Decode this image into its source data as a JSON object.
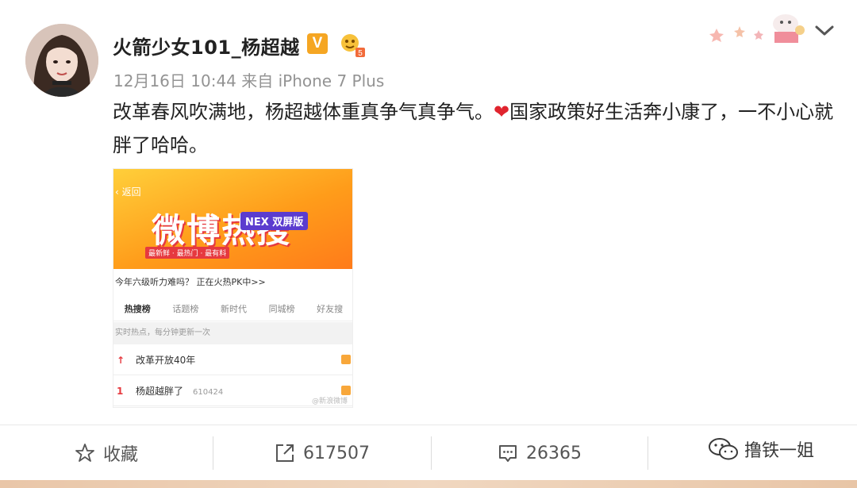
{
  "post": {
    "username": "火箭少女101_杨超越",
    "verified_badge": "V",
    "level_badge": "5",
    "meta": "12月16日 10:44 来自 iPhone 7 Plus",
    "content_before_emoji": "改革春风吹满地，杨超越体重真争气真争气。",
    "emoji": "❤",
    "content_after_emoji": "国家政策好生活奔小康了，一不小心就胖了哈哈。",
    "colors": {
      "accent": "#f5a623",
      "heart": "#e0242e"
    }
  },
  "image": {
    "back_label": "返回",
    "banner_title": "微博热搜",
    "nex_tag": "NEX 双屏版",
    "banner_sub": "最新鲜 · 最热门 · 最有料",
    "promo": "今年六级听力难吗？ 正在火热PK中>>",
    "tabs": [
      {
        "label": "热搜榜"
      },
      {
        "label": "话题榜"
      },
      {
        "label": "新时代"
      },
      {
        "label": "同城榜"
      },
      {
        "label": "好友搜"
      }
    ],
    "section_hint": "实时热点，每分钟更新一次",
    "rows": [
      {
        "rank": "↑",
        "text": "改革开放40年",
        "count": ""
      },
      {
        "rank": "1",
        "text": "杨超越胖了",
        "count": "610424"
      }
    ],
    "watermark": "@新浪微博"
  },
  "actions": {
    "favorite": "收藏",
    "repost": "617507",
    "comment": "26365"
  },
  "watermark": {
    "text": "撸铁一姐",
    "icon": "wechat-icon"
  }
}
